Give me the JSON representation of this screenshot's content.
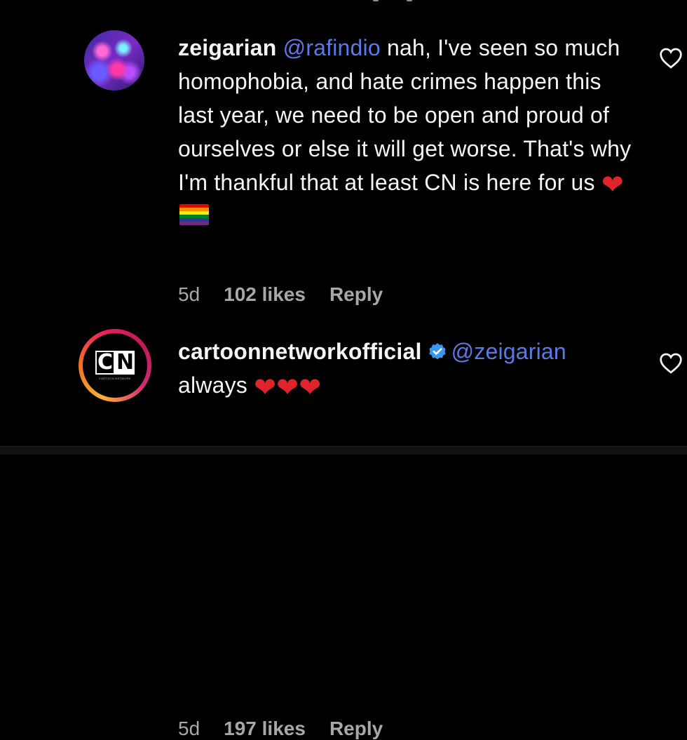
{
  "comments": [
    {
      "username": "zeigarian",
      "mention": "@rafindio",
      "text": "nah, I've seen so much homophobia, and hate crimes happen this last year, we need to be open and proud of ourselves or else it will get worse. That's why I'm thankful that at least CN is here for us",
      "emoji": "❤️🏳️‍🌈",
      "age": "5d",
      "likes": "102 likes",
      "reply_label": "Reply"
    },
    {
      "username": "cartoonnetworkofficial",
      "verified": true,
      "mention": "@zeigarian",
      "text": "always",
      "emoji": "❤️❤️❤️",
      "age": "5d",
      "likes": "197 likes",
      "reply_label": "Reply",
      "avatar_logo_left": "C",
      "avatar_logo_right": "N",
      "avatar_logo_sub": "CARTOON NETWORK"
    }
  ],
  "colors": {
    "background": "#000000",
    "text": "#f5f5f5",
    "mention": "#5b7ae6",
    "meta": "#a8a8a8",
    "verified": "#3897f0",
    "heart": "#e0242b"
  },
  "icons": {
    "like": "heart-outline-icon",
    "verified": "verified-badge-icon",
    "heart_emoji": "red-heart-emoji",
    "flag_emoji": "rainbow-flag-emoji"
  }
}
